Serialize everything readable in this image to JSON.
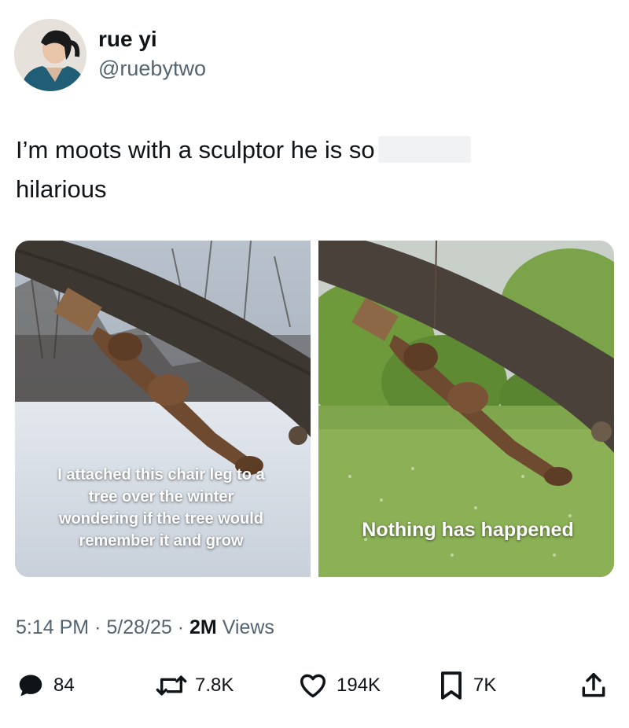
{
  "user": {
    "name": "rue yi",
    "handle": "@ruebytwo"
  },
  "tweet": {
    "text_line1": "I’m moots with a sculptor he is so",
    "text_line2": "hilarious"
  },
  "photos": {
    "left_caption": "I attached this chair leg to a tree over the winter wondering if the tree would remember it and grow",
    "right_caption": "Nothing has happened"
  },
  "meta": {
    "time": "5:14 PM",
    "sep1": "·",
    "date": "5/28/25",
    "sep2": "·",
    "views_count": "2M",
    "views_label": "Views"
  },
  "actions": {
    "replies": "84",
    "reposts": "7.8K",
    "likes": "194K",
    "bookmarks": "7K"
  },
  "icons": [
    "reply-icon",
    "repost-icon",
    "like-icon",
    "bookmark-icon",
    "share-icon"
  ]
}
